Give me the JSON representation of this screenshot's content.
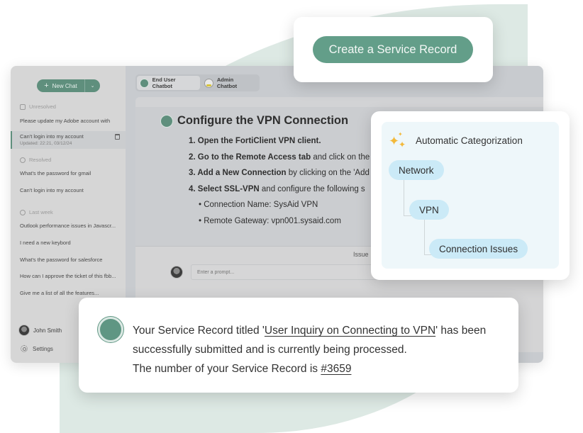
{
  "sidebar": {
    "new_chat_label": "New Chat",
    "sections": {
      "unresolved": "Unresolved",
      "resolved": "Resolved",
      "last_week": "Last week"
    },
    "unresolved_items": [
      {
        "label": "Please update my Adobe account with"
      },
      {
        "label": "Can't login into my account",
        "updated": "Updated: 22:21, 03/12/24",
        "active": true
      }
    ],
    "resolved_items": [
      {
        "label": "What's the password for gmail"
      },
      {
        "label": "Can't login into my account"
      }
    ],
    "last_week_items": [
      {
        "label": "Outlook performance issues in Javascr..."
      },
      {
        "label": "I need a new keybord"
      },
      {
        "label": "What's the password for salesforce"
      },
      {
        "label": "How can I approve the ticket of this fbb..."
      },
      {
        "label": "Give me a list of all the features..."
      }
    ],
    "user_name": "John Smith",
    "settings_label": "Settings"
  },
  "tabs": [
    {
      "label": "End User Chatbot",
      "active": true
    },
    {
      "label": "Admin Chatbot",
      "active": false
    }
  ],
  "conversation": {
    "title": "Configure the VPN Connection",
    "steps": [
      {
        "bold": "1. Open the FortiClient VPN client.",
        "rest": ""
      },
      {
        "bold": "2. Go to the Remote Access tab",
        "rest": " and click on the"
      },
      {
        "bold": "3. Add a New Connection",
        "rest": " by clicking on the 'Add"
      },
      {
        "bold": "4. Select SSL-VPN",
        "rest": " and configure the following s"
      }
    ],
    "bullets": [
      "• Connection Name: SysAid VPN",
      "• Remote Gateway: vpn001.sysaid.com"
    ],
    "issue_label": "Issue",
    "prompt_placeholder": "Enter a prompt..."
  },
  "create_card": {
    "button_label": "Create a Service Record"
  },
  "categorization": {
    "title": "Automatic Categorization",
    "levels": [
      "Network",
      "VPN",
      "Connection Issues"
    ]
  },
  "message": {
    "prefix": "Your Service Record titled '",
    "record_title": "User Inquiry on Connecting to VPN",
    "after_title": "' has been successfully submitted and is currently being processed.",
    "number_prefix": "The number of your Service Record is ",
    "record_number": "#3659"
  },
  "colors": {
    "brand_green": "#639e89",
    "pill_blue": "#cbeaf7",
    "sparkle_gold": "#f3b93a",
    "background_blob": "#dde9e4"
  }
}
